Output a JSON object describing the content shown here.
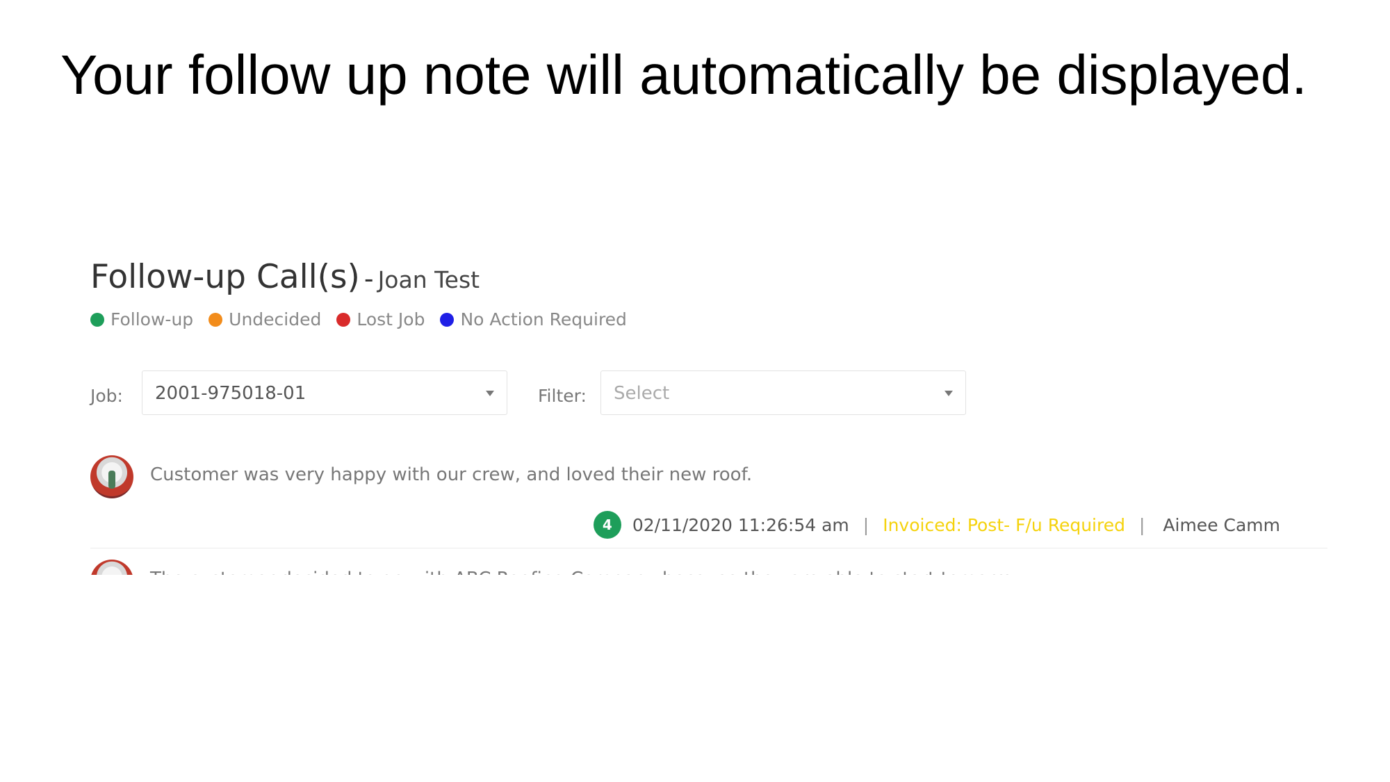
{
  "slide": {
    "title": "Your follow up note will automatically be displayed."
  },
  "panel": {
    "title": "Follow-up Call(s)",
    "separator": "-",
    "customer_name": "Joan Test",
    "legend": [
      {
        "label": "Follow-up",
        "color": "#1e9e5a"
      },
      {
        "label": "Undecided",
        "color": "#f28c1b"
      },
      {
        "label": "Lost Job",
        "color": "#d92b2b"
      },
      {
        "label": "No Action Required",
        "color": "#1f1fe6"
      }
    ],
    "job": {
      "label": "Job:",
      "value": "2001-975018-01"
    },
    "filter": {
      "label": "Filter:",
      "placeholder": "Select"
    },
    "notes": [
      {
        "text": "Customer was very happy with our crew, and loved their new roof.",
        "count": "4",
        "timestamp": "02/11/2020 11:26:54 am",
        "status": "Invoiced: Post- F/u Required",
        "user": "Aimee Camm",
        "status_color": "#f5d20c"
      },
      {
        "text": "The customer decided to go with ABC Roofing Company because they are able to start tomorrow."
      }
    ],
    "meta_separator": "|"
  }
}
